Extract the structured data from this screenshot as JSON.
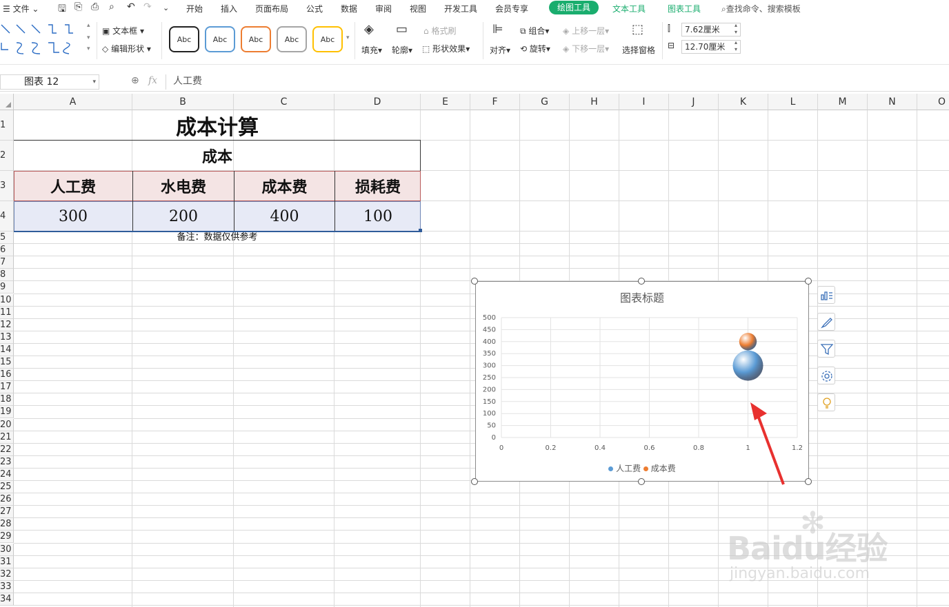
{
  "menubar": {
    "file": "文件",
    "tabs": [
      "开始",
      "插入",
      "页面布局",
      "公式",
      "数据",
      "审阅",
      "视图",
      "开发工具",
      "会员专享"
    ],
    "active_tab": "绘图工具",
    "green_tabs": [
      "文本工具",
      "图表工具"
    ],
    "search": "查找命令、搜索模板"
  },
  "ribbon": {
    "textbox": "文本框",
    "edit_shape": "编辑形状",
    "style_samples": [
      "Abc",
      "Abc",
      "Abc",
      "Abc",
      "Abc"
    ],
    "style_colors": [
      "#222222",
      "#5b9bd5",
      "#ed7d31",
      "#a5a5a5",
      "#ffc000"
    ],
    "fill": "填充",
    "outline": "轮廓",
    "format_brush": "格式刷",
    "shape_effect": "形状效果",
    "align": "对齐",
    "group": "组合",
    "rotate": "旋转",
    "bring_forward": "上移一层",
    "send_backward": "下移一层",
    "selection_pane": "选择窗格",
    "height": "7.62厘米",
    "width": "12.70厘米"
  },
  "formula": {
    "name_box": "图表 12",
    "fx": "fx",
    "content": "人工费"
  },
  "columns": [
    "A",
    "B",
    "C",
    "D",
    "E",
    "F",
    "G",
    "H",
    "I",
    "J",
    "K",
    "L",
    "M",
    "N",
    "O"
  ],
  "rows": [
    "1",
    "2",
    "3",
    "4",
    "5",
    "6",
    "7",
    "8",
    "9",
    "10",
    "11",
    "12",
    "13",
    "14",
    "15",
    "16",
    "17",
    "18",
    "19",
    "20",
    "21",
    "22",
    "23",
    "24",
    "25",
    "26",
    "27",
    "28",
    "29",
    "30",
    "31",
    "32",
    "33",
    "34"
  ],
  "sheet": {
    "title": "成本计算",
    "subtitle": "成本",
    "headers": [
      "人工费",
      "水电费",
      "成本费",
      "损耗费"
    ],
    "values": [
      "300",
      "200",
      "400",
      "100"
    ],
    "note": "备注：数据仅供参考"
  },
  "chart_data": {
    "type": "scatter",
    "title": "图表标题",
    "series": [
      {
        "name": "人工费",
        "color": "#5b9bd5",
        "points": [
          {
            "x": 1,
            "y": 300,
            "size": 300
          }
        ]
      },
      {
        "name": "成本费",
        "color": "#ed7d31",
        "points": [
          {
            "x": 1,
            "y": 400,
            "size": 100
          }
        ]
      }
    ],
    "xlim": [
      0,
      1.2
    ],
    "xticks": [
      "0",
      "0.2",
      "0.4",
      "0.6",
      "0.8",
      "1",
      "1.2"
    ],
    "ylim": [
      0,
      500
    ],
    "yticks": [
      "0",
      "50",
      "100",
      "150",
      "200",
      "250",
      "300",
      "350",
      "400",
      "450",
      "500"
    ],
    "grid": true,
    "legend": "bottom"
  },
  "chart_side_buttons": [
    "chart-elements-icon",
    "chart-style-icon",
    "chart-filter-icon",
    "settings-icon",
    "lightbulb-icon"
  ],
  "watermark": {
    "brand": "Baidu经验",
    "url": "jingyan.baidu.com"
  }
}
